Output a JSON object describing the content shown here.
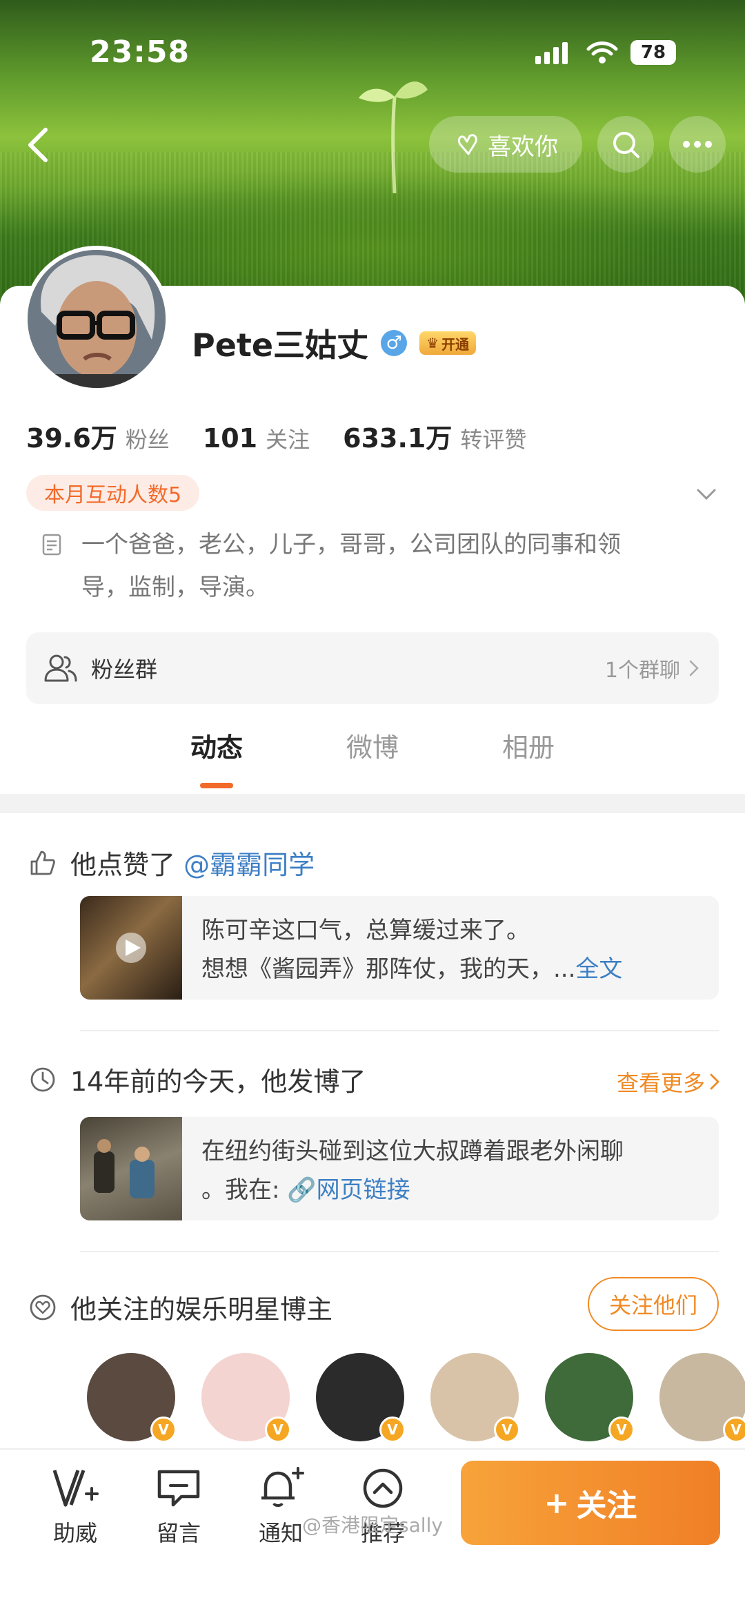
{
  "status": {
    "time": "23:58",
    "battery": "78"
  },
  "topbar": {
    "like_label": "喜欢你"
  },
  "profile": {
    "name": "Pete三姑丈",
    "vip_label": "开通",
    "stats": [
      {
        "num": "39.6万",
        "label": "粉丝"
      },
      {
        "num": "101",
        "label": "关注"
      },
      {
        "num": "633.1万",
        "label": "转评赞"
      }
    ],
    "badge": "本月互动人数5",
    "bio_line1": "一个爸爸，老公，儿子，哥哥，公司团队的同事和领",
    "bio_line2": "导，监制，导演。"
  },
  "fangroup": {
    "label": "粉丝群",
    "right": "1个群聊"
  },
  "tabs": [
    {
      "label": "动态"
    },
    {
      "label": "微博"
    },
    {
      "label": "相册"
    }
  ],
  "liked": {
    "prefix": "他点赞了",
    "user": "@霸霸同学",
    "line1": "陈可辛这口气，总算缓过来了。",
    "line2": "想想《酱园弄》那阵仗，我的天，...",
    "full": "全文"
  },
  "memory": {
    "title": "14年前的今天，他发博了",
    "more": "查看更多",
    "line1": "在纽约街头碰到这位大叔蹲着跟老外闲聊",
    "line2_prefix": "。我在:",
    "line2_link": "网页链接"
  },
  "stars": {
    "title": "他关注的娱乐明星博主",
    "button": "关注他们",
    "avatar_colors": [
      "#5a4a40",
      "#f4d4d0",
      "#2b2b2b",
      "#d9c3a8",
      "#3f6a3a",
      "#c8b8a0"
    ]
  },
  "bottom": {
    "items": [
      {
        "label": "助威"
      },
      {
        "label": "留言"
      },
      {
        "label": "通知"
      },
      {
        "label": "推荐"
      }
    ],
    "follow": "关注",
    "watermark": "@香港限定sally"
  }
}
